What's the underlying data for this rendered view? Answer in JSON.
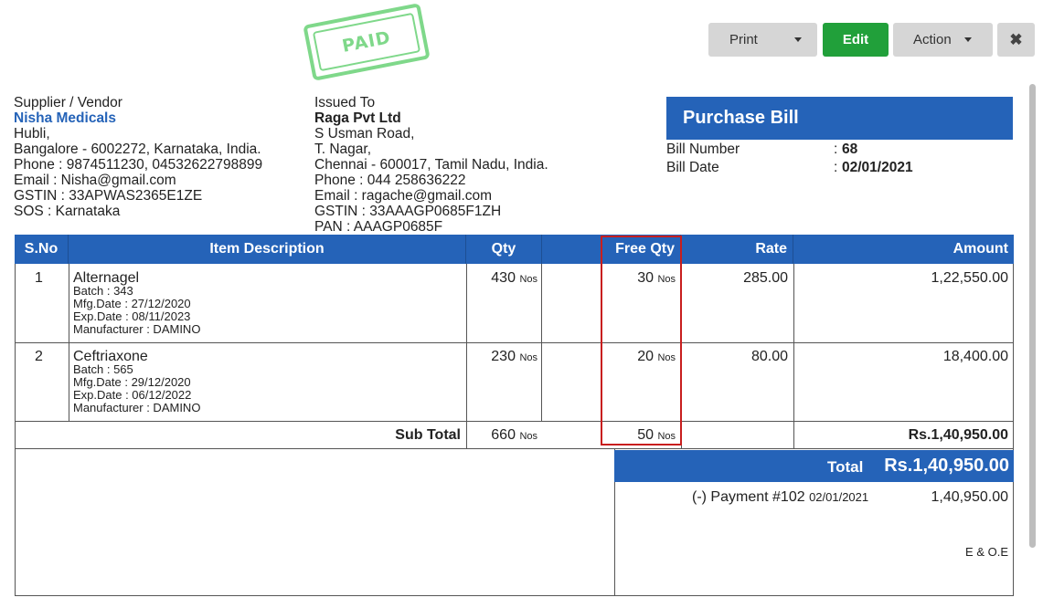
{
  "stamp": {
    "text": "PAID",
    "color": "#7fd88a"
  },
  "toolbar": {
    "print": "Print",
    "edit": "Edit",
    "action": "Action",
    "close": "✖"
  },
  "supplier": {
    "heading": "Supplier / Vendor",
    "name": "Nisha Medicals",
    "lines": [
      "Hubli,",
      "Bangalore - 6002272, Karnataka, India.",
      "Phone : 9874511230, 04532622798899",
      "Email : Nisha@gmail.com",
      "GSTIN : 33APWAS2365E1ZE",
      "SOS : Karnataka"
    ]
  },
  "issued_to": {
    "heading": "Issued To",
    "name": "Raga Pvt Ltd",
    "lines": [
      "S Usman Road,",
      "T. Nagar,",
      "Chennai - 600017, Tamil Nadu, India.",
      "Phone : 044 258636222",
      "Email : ragache@gmail.com",
      "GSTIN : 33AAAGP0685F1ZH",
      "PAN : AAAGP0685F"
    ]
  },
  "bill": {
    "title": "Purchase Bill",
    "number_label": "Bill Number",
    "number": "68",
    "date_label": "Bill Date",
    "date": "02/01/2021",
    "sep": ":"
  },
  "table": {
    "headers": [
      "S.No",
      "Item Description",
      "Qty",
      "Free Qty",
      "Rate",
      "Amount"
    ],
    "unit": "Nos",
    "rows": [
      {
        "sno": "1",
        "name": "Alternagel",
        "batch": "Batch : 343",
        "mfg": "Mfg.Date : 27/12/2020",
        "exp": "Exp.Date : 08/11/2023",
        "manufacturer": "Manufacturer : DAMINO",
        "qty": "430",
        "free_qty": "30",
        "rate": "285.00",
        "amount": "1,22,550.00"
      },
      {
        "sno": "2",
        "name": "Ceftriaxone",
        "batch": "Batch : 565",
        "mfg": "Mfg.Date : 29/12/2020",
        "exp": "Exp.Date : 06/12/2022",
        "manufacturer": "Manufacturer : DAMINO",
        "qty": "230",
        "free_qty": "20",
        "rate": "80.00",
        "amount": "18,400.00"
      }
    ],
    "subtotal": {
      "label": "Sub Total",
      "qty": "660",
      "free_qty": "50",
      "amount": "Rs.1,40,950.00"
    }
  },
  "totals": {
    "label": "Total",
    "amount": "Rs.1,40,950.00",
    "payment_label": "(-) Payment #102",
    "payment_date": "02/01/2021",
    "payment_amount": "1,40,950.00",
    "eoe": "E & O.E"
  },
  "colors": {
    "accent": "#2563b8",
    "edit": "#21a03a",
    "highlight": "#c81e1e"
  }
}
